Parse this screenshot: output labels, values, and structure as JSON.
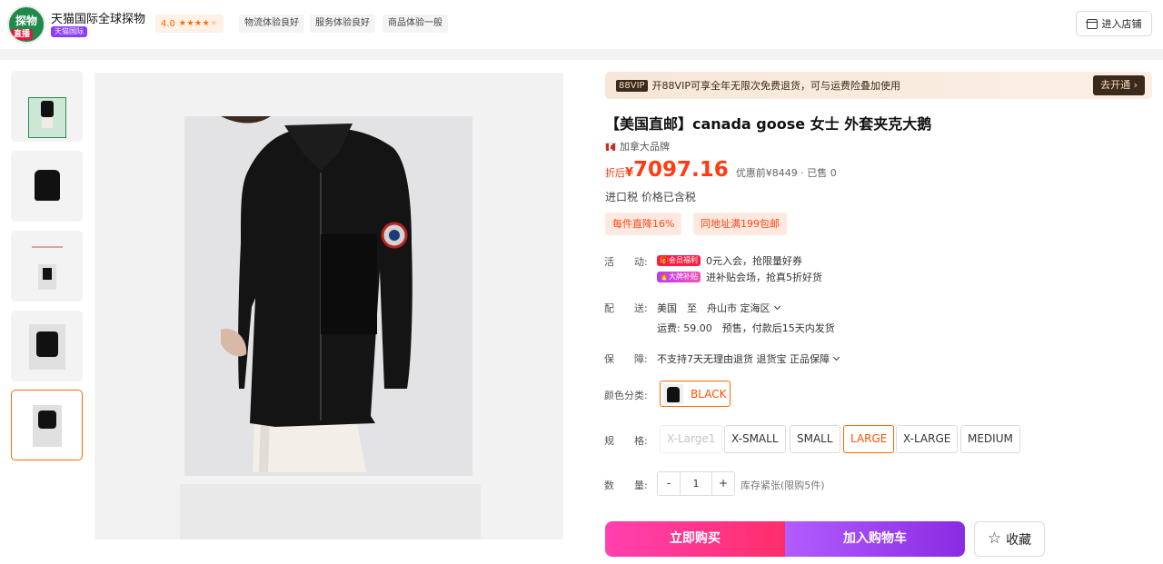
{
  "shop": {
    "logo_text": "探物",
    "live_label": "直播",
    "name": "天猫国际全球探物",
    "tag": "天猫国际",
    "rating": "4.0",
    "stars_filled": 4,
    "experience": [
      "物流体验良好",
      "服务体验良好",
      "商品体验一般"
    ],
    "enter_label": "进入店铺",
    "enter_icon": "store-icon"
  },
  "vip": {
    "badge": "88VIP",
    "text": "开88VIP可享全年无限次免费退货，可与运费险叠加使用",
    "button": "去开通 ›"
  },
  "product": {
    "title": "【美国直邮】canada goose 女士 外套夹克大鹅",
    "brand_origin": "加拿大品牌",
    "price_prefix": "折后",
    "currency": "¥",
    "price": "7097.16",
    "original_price": "优惠前¥8449 · 已售 0",
    "tax_note": "进口税 价格已含税",
    "promos": [
      "每件直降16%",
      "同地址满199包邮"
    ]
  },
  "activity": {
    "label": "活　　动:",
    "items": [
      {
        "tag": "🎁会员福利",
        "text": "0元入会，抢限量好券"
      },
      {
        "tag": "🔥大牌补贴",
        "text": "进补贴会场，抢真5折好货"
      }
    ]
  },
  "shipping": {
    "label": "配　　送:",
    "route": "美国　至　舟山市 定海区",
    "fee": "运费: 59.00　预售，付款后15天内发货"
  },
  "guarantee": {
    "label": "保　　障:",
    "text": "不支持7天无理由退货 退货宝 正品保障"
  },
  "color": {
    "label": "颜色分类:",
    "selected": "BLACK"
  },
  "size": {
    "label": "规　　格:",
    "options": [
      "X-Large1",
      "X-SMALL",
      "SMALL",
      "LARGE",
      "X-LARGE",
      "MEDIUM"
    ],
    "selected": "LARGE",
    "disabled": [
      "X-Large1"
    ]
  },
  "quantity": {
    "label": "数　　量:",
    "minus": "-",
    "value": "1",
    "plus": "+",
    "stock_note": "库存紧张(限购5件)"
  },
  "actions": {
    "buy": "立即购买",
    "cart": "加入购物车",
    "favorite": "收藏"
  },
  "colors": {
    "accent": "#ff5000",
    "buy_gradient": [
      "#ff40b0",
      "#ff2d6a"
    ],
    "cart_gradient": [
      "#b15cff",
      "#8a2be2"
    ]
  }
}
